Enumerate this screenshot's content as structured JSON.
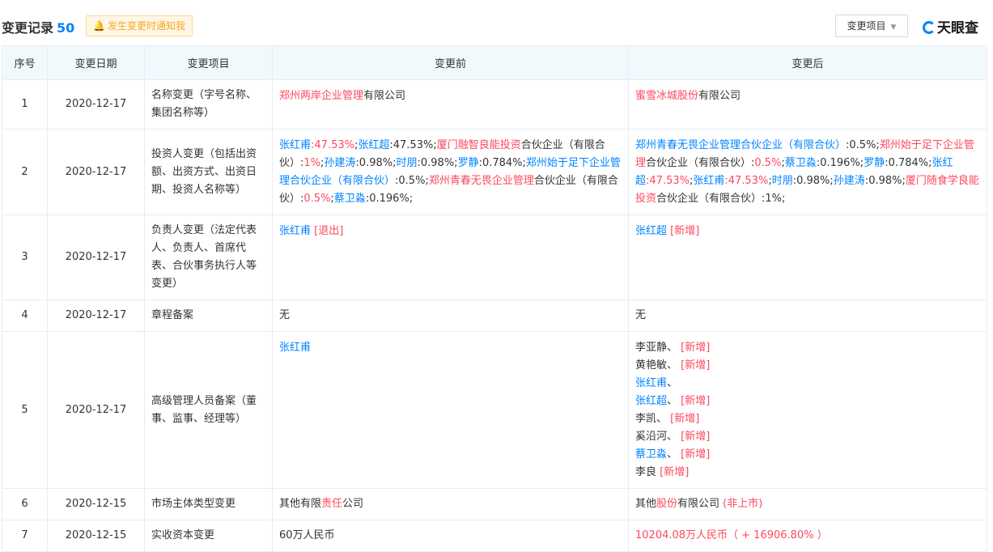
{
  "header": {
    "title": "变更记录",
    "count": "50",
    "notify_label": "发生变更时通知我",
    "filter_label": "变更项目",
    "logo_text": "天眼查"
  },
  "columns": [
    "序号",
    "变更日期",
    "变更项目",
    "变更前",
    "变更后"
  ],
  "rows": [
    {
      "no": "1",
      "date": "2020-12-17",
      "item": "名称变更（字号名称、集团名称等）",
      "before": [
        {
          "t": "郑州两岸企业管理",
          "c": "r"
        },
        {
          "t": "有限公司",
          "c": ""
        }
      ],
      "after": [
        {
          "t": "蜜雪冰城股份",
          "c": "r"
        },
        {
          "t": "有限公司",
          "c": ""
        }
      ]
    },
    {
      "no": "2",
      "date": "2020-12-17",
      "item": "投资人变更（包括出资额、出资方式、出资日期、投资人名称等）",
      "before": [
        {
          "t": "张红甫",
          "c": "b"
        },
        {
          "t": ":47.53%",
          "c": "r"
        },
        {
          "t": ";",
          "c": ""
        },
        {
          "t": "张红超",
          "c": "b"
        },
        {
          "t": ":47.53%;",
          "c": ""
        },
        {
          "t": "厦门融智良能投资",
          "c": "r"
        },
        {
          "t": "合伙企业（有限合伙）:",
          "c": ""
        },
        {
          "t": "1%",
          "c": "r"
        },
        {
          "t": ";",
          "c": ""
        },
        {
          "t": "孙建涛",
          "c": "b"
        },
        {
          "t": ":0.98%;",
          "c": ""
        },
        {
          "t": "时朋",
          "c": "b"
        },
        {
          "t": ":0.98%;",
          "c": ""
        },
        {
          "t": "罗静",
          "c": "b"
        },
        {
          "t": ":0.784%;",
          "c": ""
        },
        {
          "t": "郑州始于足下企业管理合伙企业（有限合伙）",
          "c": "b"
        },
        {
          "t": ":0.5%;",
          "c": ""
        },
        {
          "t": "郑州青春无畏企业管理",
          "c": "r"
        },
        {
          "t": "合伙企业（有限合伙）:",
          "c": ""
        },
        {
          "t": "0.5%",
          "c": "r"
        },
        {
          "t": ";",
          "c": ""
        },
        {
          "t": "蔡卫淼",
          "c": "b"
        },
        {
          "t": ":0.196%;",
          "c": ""
        }
      ],
      "after": [
        {
          "t": "郑州青春无畏企业管理合伙企业（有限合伙）",
          "c": "b"
        },
        {
          "t": ":0.5%;",
          "c": ""
        },
        {
          "t": "郑州始于足下企业管理",
          "c": "r"
        },
        {
          "t": "合伙企业（有限合伙）:",
          "c": ""
        },
        {
          "t": "0.5%",
          "c": "r"
        },
        {
          "t": ";",
          "c": ""
        },
        {
          "t": "蔡卫淼",
          "c": "b"
        },
        {
          "t": ":0.196%;",
          "c": ""
        },
        {
          "t": "罗静",
          "c": "b"
        },
        {
          "t": ":0.784%;",
          "c": ""
        },
        {
          "t": "张红超",
          "c": "b"
        },
        {
          "t": ":47.53%",
          "c": "r"
        },
        {
          "t": ";",
          "c": ""
        },
        {
          "t": "张红甫",
          "c": "b"
        },
        {
          "t": ":47.53%",
          "c": "r"
        },
        {
          "t": ";",
          "c": ""
        },
        {
          "t": "时朋",
          "c": "b"
        },
        {
          "t": ":0.98%;",
          "c": ""
        },
        {
          "t": "孙建涛",
          "c": "b"
        },
        {
          "t": ":0.98%;",
          "c": ""
        },
        {
          "t": "厦门随食学良能投资",
          "c": "r"
        },
        {
          "t": "合伙企业（有限合伙）:1%;",
          "c": ""
        }
      ]
    },
    {
      "no": "3",
      "date": "2020-12-17",
      "item": "负责人变更（法定代表人、负责人、首席代表、合伙事务执行人等变更）",
      "before": [
        {
          "t": "张红甫",
          "c": "b"
        },
        {
          "t": " [退出]",
          "c": "r"
        }
      ],
      "after": [
        {
          "t": "张红超",
          "c": "b"
        },
        {
          "t": " [新增]",
          "c": "r"
        }
      ]
    },
    {
      "no": "4",
      "date": "2020-12-17",
      "item": "章程备案",
      "before": [
        {
          "t": "无",
          "c": ""
        }
      ],
      "after": [
        {
          "t": "无",
          "c": ""
        }
      ]
    },
    {
      "no": "5",
      "date": "2020-12-17",
      "item": "高级管理人员备案（董事、监事、经理等）",
      "before": [
        {
          "t": "张红甫",
          "c": "b"
        }
      ],
      "after": [
        {
          "t": "李亚静、 ",
          "c": ""
        },
        {
          "t": "[新增]",
          "c": "r"
        },
        {
          "t": "\n",
          "c": ""
        },
        {
          "t": "黄艳敏、 ",
          "c": ""
        },
        {
          "t": "[新增]",
          "c": "r"
        },
        {
          "t": "\n",
          "c": ""
        },
        {
          "t": "张红甫",
          "c": "b"
        },
        {
          "t": "、",
          "c": ""
        },
        {
          "t": "\n",
          "c": ""
        },
        {
          "t": "张红超",
          "c": "b"
        },
        {
          "t": "、 ",
          "c": ""
        },
        {
          "t": "[新增]",
          "c": "r"
        },
        {
          "t": "\n",
          "c": ""
        },
        {
          "t": "李凯、 ",
          "c": ""
        },
        {
          "t": "[新增]",
          "c": "r"
        },
        {
          "t": "\n",
          "c": ""
        },
        {
          "t": "奚沿河、 ",
          "c": ""
        },
        {
          "t": "[新增]",
          "c": "r"
        },
        {
          "t": "\n",
          "c": ""
        },
        {
          "t": "蔡卫淼",
          "c": "b"
        },
        {
          "t": "、 ",
          "c": ""
        },
        {
          "t": "[新增]",
          "c": "r"
        },
        {
          "t": "\n",
          "c": ""
        },
        {
          "t": "李良 ",
          "c": ""
        },
        {
          "t": "[新增]",
          "c": "r"
        }
      ]
    },
    {
      "no": "6",
      "date": "2020-12-15",
      "item": "市场主体类型变更",
      "before": [
        {
          "t": "其他有限",
          "c": ""
        },
        {
          "t": "责任",
          "c": "r"
        },
        {
          "t": "公司",
          "c": ""
        }
      ],
      "after": [
        {
          "t": "其他",
          "c": ""
        },
        {
          "t": "股份",
          "c": "r"
        },
        {
          "t": "有限公司 ",
          "c": ""
        },
        {
          "t": "(非上市)",
          "c": "r"
        }
      ]
    },
    {
      "no": "7",
      "date": "2020-12-15",
      "item": "实收资本变更",
      "before": [
        {
          "t": "60万人民币",
          "c": ""
        }
      ],
      "after": [
        {
          "t": "10204.08万人民币（ + 16906.80% ）",
          "c": "r"
        }
      ]
    }
  ],
  "colors": {
    "accent": "#0084ff",
    "highlight": "#fd485e",
    "header_bg": "#f2f9fc",
    "border": "#e4eef6",
    "notify_bg": "#fff7e6"
  }
}
